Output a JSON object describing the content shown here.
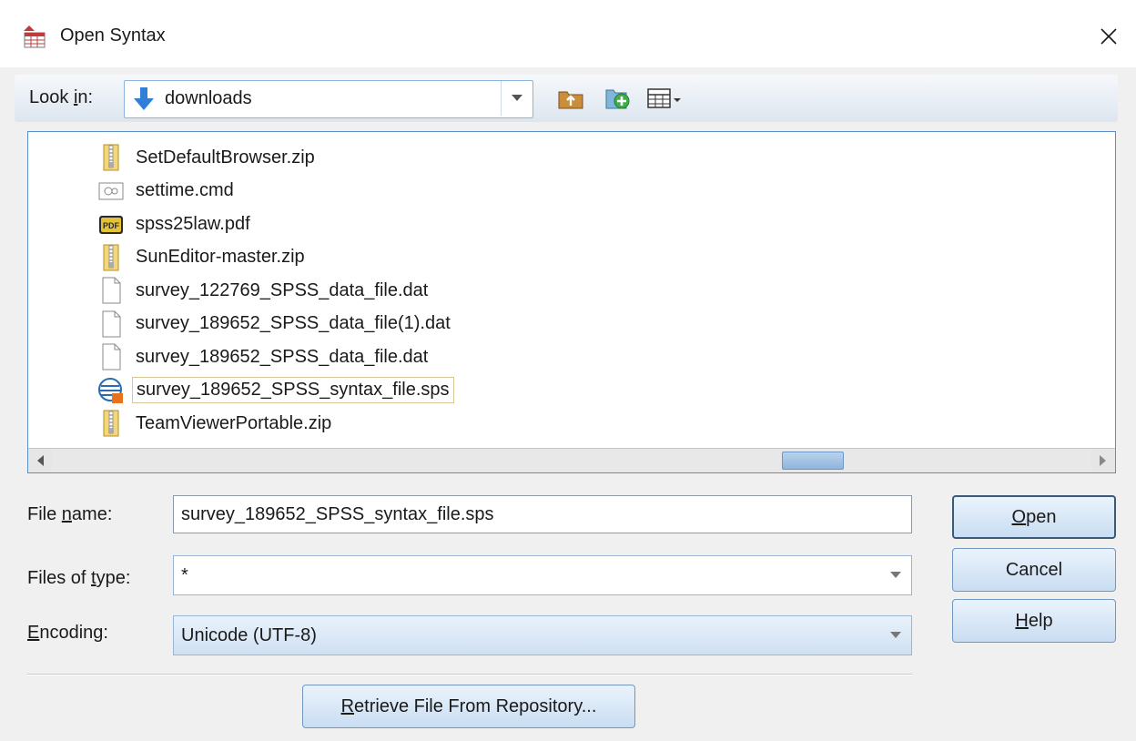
{
  "window": {
    "title": "Open Syntax"
  },
  "look_in": {
    "label": "Look in:",
    "folder": "downloads"
  },
  "toolbar": {
    "icons": [
      "folder-up-icon",
      "new-folder-icon",
      "view-menu-icon"
    ]
  },
  "files": [
    {
      "name": "SetDefaultBrowser.zip",
      "type": "zip"
    },
    {
      "name": "settime.cmd",
      "type": "cmd"
    },
    {
      "name": "spss25law.pdf",
      "type": "pdf"
    },
    {
      "name": "SunEditor-master.zip",
      "type": "zip"
    },
    {
      "name": "survey_122769_SPSS_data_file.dat",
      "type": "dat"
    },
    {
      "name": "survey_189652_SPSS_data_file(1).dat",
      "type": "dat"
    },
    {
      "name": "survey_189652_SPSS_data_file.dat",
      "type": "dat"
    },
    {
      "name": "survey_189652_SPSS_syntax_file.sps",
      "type": "sps",
      "selected": true
    },
    {
      "name": "TeamViewerPortable.zip",
      "type": "zip"
    }
  ],
  "form": {
    "file_name": {
      "label": "File name:",
      "value": "survey_189652_SPSS_syntax_file.sps"
    },
    "file_type": {
      "label": "Files of type:",
      "value": "*"
    },
    "encoding": {
      "label": "Encoding:",
      "value": "Unicode (UTF-8)"
    }
  },
  "buttons": {
    "open": "Open",
    "cancel": "Cancel",
    "help": "Help",
    "retrieve": "Retrieve File From Repository..."
  },
  "colors": {
    "accent": "#5a8fc8",
    "button_top": "#eaf3fc",
    "button_bottom": "#c9ddf2"
  }
}
